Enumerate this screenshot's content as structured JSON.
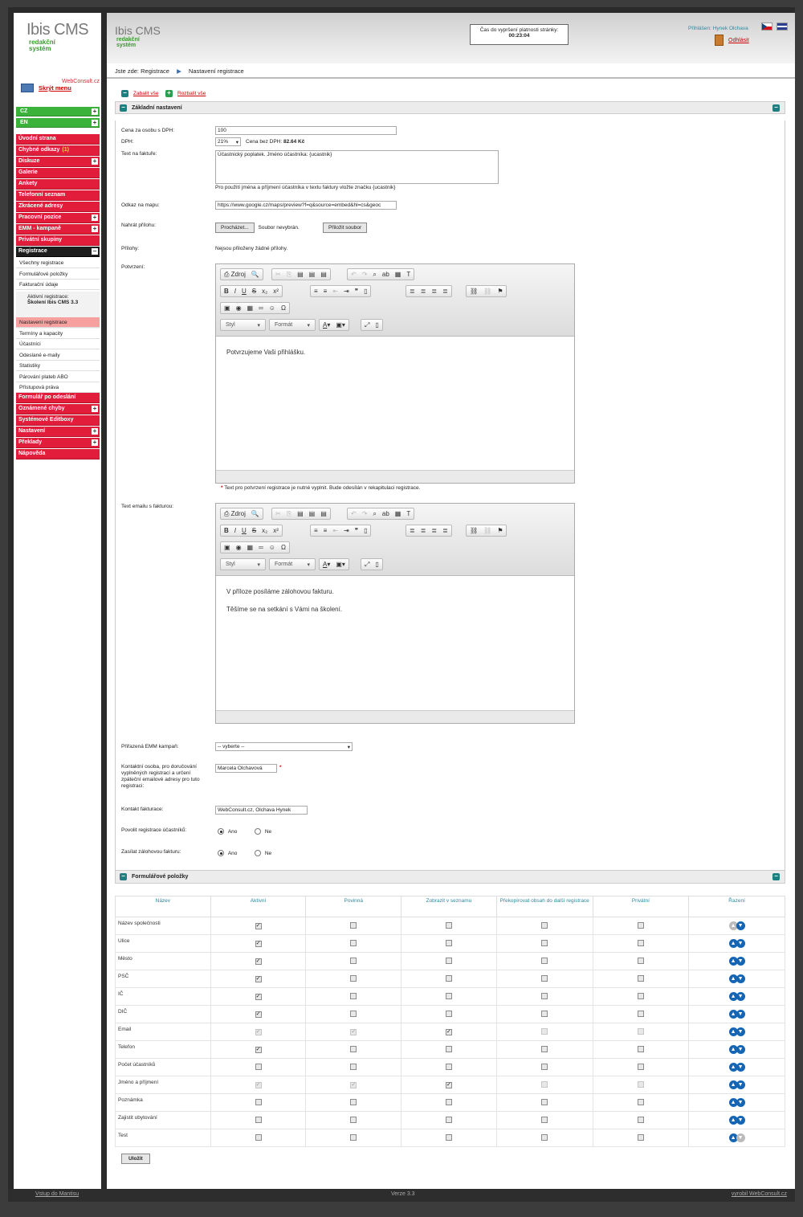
{
  "logo": {
    "line1": "Ibis CMS",
    "line2": "redakční",
    "line3": "systém",
    "webconsult": "WebConsult.cz"
  },
  "sidebar": {
    "hide_menu": "Skrýt menu",
    "langs": [
      "CZ",
      "EN"
    ],
    "menu_top": [
      "Úvodní strana",
      "Chybné odkazy",
      "Diskuze",
      "Galerie",
      "Ankety",
      "Telefonní seznam",
      "Zkrácené adresy",
      "Pracovní pozice",
      "EMM - kampaně",
      "Privátní skupiny"
    ],
    "chybne_badge": "(1)",
    "registrace": "Registrace",
    "reg_sub": [
      "Všechny registrace",
      "Formulářové položky",
      "Fakturační údaje"
    ],
    "active_reg": {
      "label": "Aktivní registrace:",
      "name": "Školení Ibis CMS 3.3"
    },
    "reg_sub2": [
      "Nastavení registrace",
      "Termíny a kapacity",
      "Účastníci",
      "Odeslané e-maily",
      "Statistiky",
      "Párování plateb ABO",
      "Přístupová práva"
    ],
    "menu_bottom": [
      "Formulář po odeslání",
      "Oznámené chyby",
      "Systémové Editboxy",
      "Nastavení",
      "Překlady",
      "Nápověda"
    ]
  },
  "header": {
    "timer_label": "Čas do vypršení platnosti stránky:",
    "timer_value": "00:23:04",
    "user_label": "Přihlášen: Hynek Olchava",
    "logout": "Odhlásit"
  },
  "breadcrumb": {
    "label": "Jste zde:",
    "items": [
      "Registrace",
      "Nastavení registrace"
    ]
  },
  "expand": {
    "collapse_all": "Zabalit vše",
    "expand_all": "Rozbalit vše"
  },
  "basic": {
    "title": "Základní nastavení",
    "price_label": "Cena za osobu s DPH:",
    "price_value": "100",
    "vat_label": "DPH:",
    "vat_value": "21%",
    "price_novat_label": "Cena bez DPH:",
    "price_novat_value": "82.64 Kč",
    "invoice_text_label": "Text na faktuře:",
    "invoice_text_value": "Účastnický poplatek. Jméno účastníka: {ucastnik}",
    "invoice_hint": "Pro použití jména a příjmení účastníka v textu faktury vložte značku {ucastnik}",
    "map_label": "Odkaz na mapu:",
    "map_value": "https://www.google.cz/maps/preview?f=q&source=embed&hl=cs&geoc",
    "upload_label": "Nahrát přílohu:",
    "browse": "Procházet...",
    "no_file": "Soubor nevybrán.",
    "attach_btn": "Přiložit soubor",
    "attachments_label": "Přílohy:",
    "attachments_value": "Nejsou přiloženy žádné přílohy.",
    "confirm_label": "Potvrzení:",
    "confirm_text": "Potvrzujeme Vaši přihlášku.",
    "confirm_note": "Text pro potvrzení registrace je nutné vyplnit. Bude odesílán v rekapitulaci registrace.",
    "email_label": "Text emailu s fakturou:",
    "email_p1": "V příloze posíláme zálohovou fakturu.",
    "email_p2": "Těšíme se na setkání s Vámi na školení.",
    "emm_label": "Přiřazená EMM kampaň:",
    "emm_value": "-- vyberte --",
    "contact_label": "Kontaktní osoba, pro doručování vyplněných registrací a určení zpáteční emailové adresy pro tuto registraci:",
    "contact_value": "Marcela Olchavová",
    "billing_label": "Kontakt fakturace:",
    "billing_value": "WebConsult.cz, Olchava Hynek",
    "allow_label": "Povolit registrace účastníků:",
    "send_invoice_label": "Zasílat zálohovou fakturu:",
    "yes": "Ano",
    "no": "Ne"
  },
  "editor": {
    "source": "Zdroj",
    "style": "Styl",
    "format": "Formát"
  },
  "form_items": {
    "title": "Formulářové položky",
    "columns": [
      "Název",
      "Aktivní",
      "Povinná",
      "Zobrazit v seznamu",
      "Překopírovat obsah do další registrace",
      "Privátní",
      "Řazení"
    ],
    "rows": [
      {
        "name": "Název společnosti",
        "active": true,
        "req": false,
        "list": false,
        "copy": false,
        "priv": false,
        "dim": false
      },
      {
        "name": "Ulice",
        "active": true,
        "req": false,
        "list": false,
        "copy": false,
        "priv": false,
        "dim": false
      },
      {
        "name": "Město",
        "active": true,
        "req": false,
        "list": false,
        "copy": false,
        "priv": false,
        "dim": false
      },
      {
        "name": "PSČ",
        "active": true,
        "req": false,
        "list": false,
        "copy": false,
        "priv": false,
        "dim": false
      },
      {
        "name": "IČ",
        "active": true,
        "req": false,
        "list": false,
        "copy": false,
        "priv": false,
        "dim": false
      },
      {
        "name": "DIČ",
        "active": true,
        "req": false,
        "list": false,
        "copy": false,
        "priv": false,
        "dim": false
      },
      {
        "name": "Email",
        "active": true,
        "req": true,
        "list": true,
        "copy": false,
        "priv": false,
        "dim": true
      },
      {
        "name": "Telefon",
        "active": true,
        "req": false,
        "list": false,
        "copy": false,
        "priv": false,
        "dim": false
      },
      {
        "name": "Počet účastníků",
        "active": false,
        "req": false,
        "list": false,
        "copy": false,
        "priv": false,
        "dim": false
      },
      {
        "name": "Jméno a příjmení",
        "active": true,
        "req": true,
        "list": true,
        "copy": false,
        "priv": false,
        "dim": true
      },
      {
        "name": "Poznámka",
        "active": false,
        "req": false,
        "list": false,
        "copy": false,
        "priv": false,
        "dim": false
      },
      {
        "name": "Zajistit ubytování",
        "active": false,
        "req": false,
        "list": false,
        "copy": false,
        "priv": false,
        "dim": false
      },
      {
        "name": "Test",
        "active": false,
        "req": false,
        "list": false,
        "copy": false,
        "priv": false,
        "dim": false
      }
    ]
  },
  "save": "Uložit",
  "footer": {
    "login": "Vstup do Mantisu",
    "version": "Verze 3.3",
    "made_by": "vyrobil WebConsult.cz"
  }
}
